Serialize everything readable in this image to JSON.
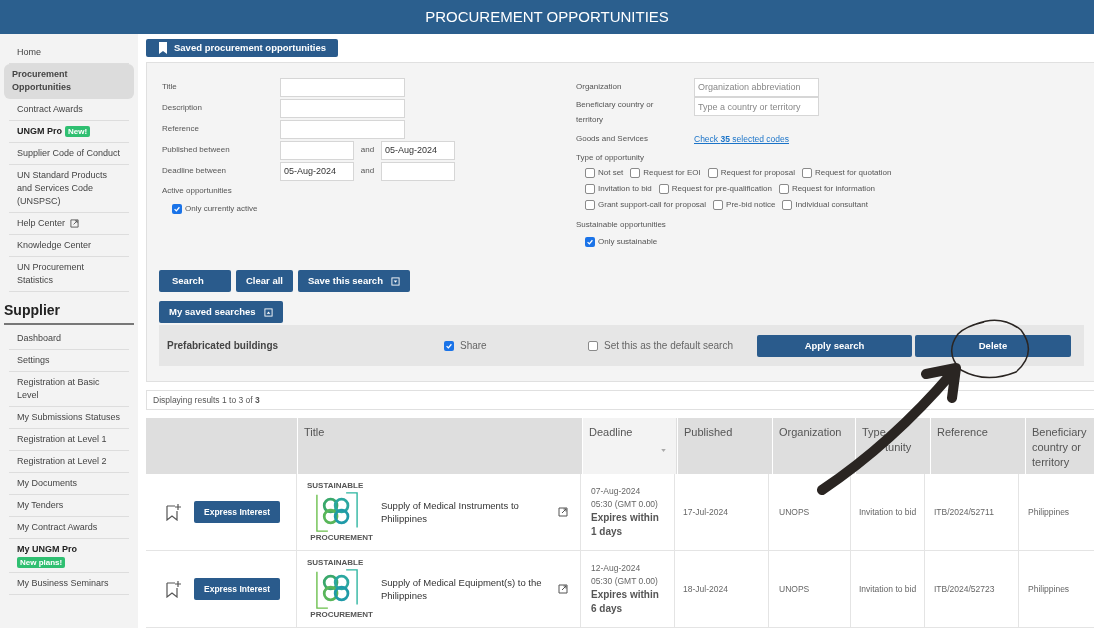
{
  "header": {
    "title": "PROCUREMENT OPPORTUNITIES"
  },
  "sidebar": {
    "items": [
      {
        "label": "Home",
        "kind": "plain",
        "selected": false
      },
      {
        "label": "Procurement Opportunities",
        "kind": "plain",
        "selected": true
      },
      {
        "label": "Contract Awards",
        "kind": "plain",
        "selected": false
      },
      {
        "label": "UNGM Pro",
        "kind": "pro",
        "badge": "New!",
        "selected": false
      },
      {
        "label": "Supplier Code of Conduct",
        "kind": "plain",
        "selected": false
      },
      {
        "label": "UN Standard Products and Services Code (UNSPSC)",
        "kind": "plain",
        "selected": false
      },
      {
        "label": "Help Center",
        "kind": "external",
        "selected": false
      },
      {
        "label": "Knowledge Center",
        "kind": "plain",
        "selected": false
      },
      {
        "label": "UN Procurement Statistics",
        "kind": "plain",
        "selected": false
      }
    ],
    "section": "Supplier",
    "section_items": [
      {
        "label": "Dashboard",
        "kind": "plain",
        "selected": false
      },
      {
        "label": "Settings",
        "kind": "plain",
        "selected": false
      },
      {
        "label": "Registration at Basic Level",
        "kind": "plain",
        "selected": false
      },
      {
        "label": "My Submissions Statuses",
        "kind": "plain",
        "selected": false
      },
      {
        "label": "Registration at Level 1",
        "kind": "plain",
        "selected": false
      },
      {
        "label": "Registration at Level 2",
        "kind": "plain",
        "selected": false
      },
      {
        "label": "My Documents",
        "kind": "plain",
        "selected": false
      },
      {
        "label": "My Tenders",
        "kind": "plain",
        "selected": false
      },
      {
        "label": "My Contract Awards",
        "kind": "plain",
        "selected": false
      },
      {
        "label": "My UNGM Pro",
        "kind": "pro",
        "badge": "New plans!",
        "selected": false
      },
      {
        "label": "My Business Seminars",
        "kind": "plain",
        "selected": false
      }
    ]
  },
  "saved_button": "Saved procurement opportunities",
  "form": {
    "left_fields": [
      {
        "kind": "text",
        "label": "Title"
      },
      {
        "kind": "text",
        "label": "Description"
      },
      {
        "kind": "text",
        "label": "Reference"
      },
      {
        "kind": "range",
        "label": "Published between",
        "and": "and",
        "to": "05-Aug-2024"
      },
      {
        "kind": "range",
        "label": "Deadline between",
        "from": "05-Aug-2024",
        "and": "and"
      }
    ],
    "active": {
      "label": "Active opportunities",
      "option": {
        "label": "Only currently active",
        "checked": true
      }
    },
    "organization": {
      "label": "Organization",
      "placeholder": "Organization abbreviation"
    },
    "beneficiary": {
      "label": "Beneficiary country or territory",
      "placeholder": "Type a country or territory"
    },
    "goods": {
      "label": "Goods and Services",
      "link": "Check **35** selected codes"
    },
    "type_of_opportunity": {
      "label": "Type of opportunity",
      "options": [
        {
          "label": "Not set",
          "checked": false
        },
        {
          "label": "Request for EOI",
          "checked": false
        },
        {
          "label": "Request for proposal",
          "checked": false
        },
        {
          "label": "Request for quotation",
          "checked": false
        },
        {
          "label": "Invitation to bid",
          "checked": false
        },
        {
          "label": "Request for pre-qualification",
          "checked": false
        },
        {
          "label": "Request for information",
          "checked": false
        },
        {
          "label": "Grant support-call for proposal",
          "checked": false
        },
        {
          "label": "Pre-bid notice",
          "checked": false
        },
        {
          "label": "Individual consultant",
          "checked": false
        }
      ]
    },
    "sustainable": {
      "label": "Sustainable opportunities",
      "option": {
        "label": "Only sustainable",
        "checked": true
      }
    },
    "buttons": [
      {
        "label": "Search",
        "kind": "plain"
      },
      {
        "label": "Clear all",
        "kind": "plain"
      },
      {
        "label": "Save this search",
        "kind": "dropdown"
      }
    ],
    "my_saved_searches": "My saved searches",
    "saved_search": {
      "name": "Prefabricated buildings",
      "share": {
        "label": "Share",
        "checked": true
      },
      "default": {
        "label": "Set this as the default search",
        "checked": false
      },
      "apply": "Apply search",
      "delete": "Delete"
    }
  },
  "results": "Displaying results 1 to 3 of **3**",
  "table": {
    "columns": [
      {
        "label": "Title",
        "sorted": false
      },
      {
        "label": "Deadline",
        "sorted": true
      },
      {
        "label": "Published",
        "sorted": false
      },
      {
        "label": "Organization",
        "sorted": false
      },
      {
        "label": "Type",
        "label_tail": "tunity",
        "sorted": false
      },
      {
        "label": "Reference",
        "sorted": false
      },
      {
        "label": "Beneficiary country or territory",
        "sorted": false
      }
    ],
    "rows": [
      {
        "action": "Express Interest",
        "logo_top": "SUSTAINABLE",
        "logo_bottom": "PROCUREMENT",
        "title": "Supply of Medical Instruments to Philippines",
        "deadline_date": "07-Aug-2024",
        "deadline_time": "05:30 (GMT 0.00)",
        "expires": "Expires within 1 days",
        "published": "17-Jul-2024",
        "organization": "UNOPS",
        "type": "Invitation to bid",
        "reference": "ITB/2024/52711",
        "beneficiary": "Philippines"
      },
      {
        "action": "Express Interest",
        "logo_top": "SUSTAINABLE",
        "logo_bottom": "PROCUREMENT",
        "title": "Supply of Medical Equipment(s) to the Philippines",
        "deadline_date": "12-Aug-2024",
        "deadline_time": "05:30 (GMT 0.00)",
        "expires": "Expires within 6 days",
        "published": "18-Jul-2024",
        "organization": "UNOPS",
        "type": "Invitation to bid",
        "reference": "ITB/2024/52723",
        "beneficiary": "Philippines"
      }
    ]
  }
}
